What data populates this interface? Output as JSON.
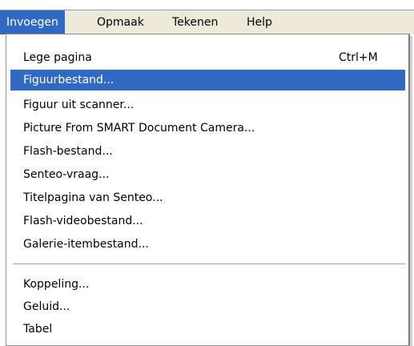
{
  "menubar": {
    "items": [
      {
        "label": "Invoegen",
        "active": true
      },
      {
        "label": "Opmaak",
        "active": false
      },
      {
        "label": "Tekenen",
        "active": false
      },
      {
        "label": "Help",
        "active": false
      }
    ]
  },
  "dropdown": {
    "items": [
      {
        "label": "Lege pagina",
        "shortcut": "Ctrl+M"
      },
      {
        "label": "Figuurbestand...",
        "shortcut": ""
      },
      {
        "label": "Figuur uit scanner...",
        "shortcut": ""
      },
      {
        "label": "Picture From SMART Document Camera...",
        "shortcut": ""
      },
      {
        "label": "Flash-bestand...",
        "shortcut": ""
      },
      {
        "label": "Senteo-vraag...",
        "shortcut": ""
      },
      {
        "label": "Titelpagina van Senteo...",
        "shortcut": ""
      },
      {
        "label": "Flash-videobestand...",
        "shortcut": ""
      },
      {
        "label": "Galerie-itembestand...",
        "shortcut": ""
      },
      {
        "label": "Koppeling...",
        "shortcut": ""
      },
      {
        "label": "Geluid...",
        "shortcut": ""
      },
      {
        "label": "Tabel",
        "shortcut": ""
      }
    ]
  },
  "colors": {
    "highlight": "#316ac5",
    "menubar_bg": "#ece9d8"
  }
}
